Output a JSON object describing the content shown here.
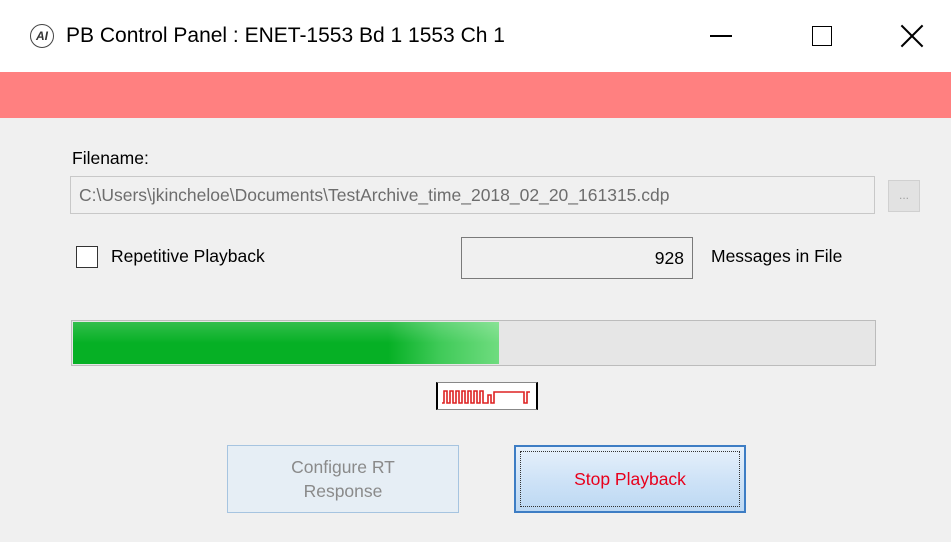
{
  "window": {
    "icon_text": "AI",
    "title": "PB Control Panel : ENET-1553 Bd 1 1553 Ch 1"
  },
  "colors": {
    "status_strip": "#ff8080",
    "progress_fill": "#06b025",
    "stop_text": "#e8001c"
  },
  "icons": {
    "minimize": "minimize-icon",
    "maximize": "maximize-icon",
    "close": "close-icon",
    "signal": "waveform-icon",
    "app": "app-logo-icon"
  },
  "form": {
    "filename_label": "Filename:",
    "filename_value": "C:\\Users\\jkincheloe\\Documents\\TestArchive_time_2018_02_20_161315.cdp",
    "browse_label": "...",
    "repetitive_label": "Repetitive Playback",
    "repetitive_checked": false,
    "message_count": "928",
    "messages_label": "Messages in File"
  },
  "progress": {
    "fraction": 0.53
  },
  "buttons": {
    "configure_label": "Configure RT\nResponse",
    "stop_label": "Stop Playback"
  }
}
